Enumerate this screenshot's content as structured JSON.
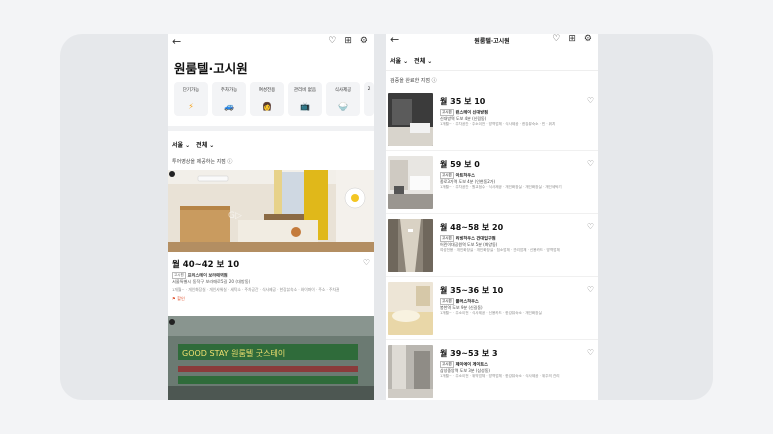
{
  "left": {
    "title": "원룸텔·고시원",
    "top_icons": [
      "heart-outline-icon",
      "map-icon",
      "filter-icon"
    ],
    "categories": [
      {
        "label": "단기가능",
        "icon": "⚡",
        "color": "#f5a623"
      },
      {
        "label": "주차가능",
        "icon": "🚙",
        "color": "#3b6fd8"
      },
      {
        "label": "여성전용",
        "icon": "👩",
        "color": "#e07a3a"
      },
      {
        "label": "관리비 없음",
        "icon": "📺",
        "color": "#3ba0d8"
      },
      {
        "label": "식사제공",
        "icon": "🍚",
        "color": "#555"
      },
      {
        "label": "2",
        "icon": "",
        "color": "#555"
      }
    ],
    "filter_region": "서울",
    "filter_all": "전체",
    "section_label": "투어영상을 제공하는 지점",
    "listing": {
      "price": "월 40~42  보 10",
      "badge": "고시원",
      "name": "프리스테이 보라매역점",
      "location": "서울특별시 동작구 보라매로5길 20 (대방동)",
      "tags": "1개월~ · 개인화장실 · 개인샤워실 · 세탁소 · 주차공간 · 식사제공 · 한강뷰숙소 · 와이파이 · 주소 · 주차권"
    },
    "photo_sign": "GOOD STAY 원룸텔 굿스테이"
  },
  "right": {
    "title": "원룸텔·고시원",
    "filter_region": "서울",
    "filter_all": "전체",
    "section_label": "검증을 완료한 지점",
    "listings": [
      {
        "price": "월 35  보 10",
        "badge": "고시원",
        "name": "런스테이 신대방점",
        "location": "신대방역 도보 4분 (신림동)",
        "tags": "1개월~ · 주차공간 · 주소이전 · 방역업체 · 식사제공 · 한강뷰숙소 · 빈 · 위치"
      },
      {
        "price": "월 59  보 0",
        "badge": "고시원",
        "name": "아트하우스",
        "location": "종로3가역 도보 4분 (인현동2가)",
        "tags": "1개월~ · 주차공간 · 원교점수 · 식사제공 · 개인화장실 · 개인화장실 · 개인세탁기"
      },
      {
        "price": "월 48~58  보 20",
        "badge": "고시원",
        "name": "리빙하우스 건대입구점",
        "location": "어린이대공원역 도보 5분 (화양동)",
        "tags": "여성전용 · 개인화장실 · 개인화장실 · 침소업체 · 관리업체 · 신용카드 · 방역업체"
      },
      {
        "price": "월 35~36  보 10",
        "badge": "고시원",
        "name": "플러스하우스",
        "location": "봉천역 도보 9분 (신길동)",
        "tags": "1개월~ · 주소이전 · 식사제공 · 신용카드 · 한강뷰숙소 · 개인화장실"
      },
      {
        "price": "월 39~53  보 3",
        "badge": "고시원",
        "name": "제이에이 게이트스",
        "location": "삼성중앙역 도보 3분 (삼성동)",
        "tags": "1개월~ · 주소이전 · 위약업체 · 방역업체 · 한강뷰숙소 · 식사제공 · 위주의 관리"
      }
    ]
  }
}
